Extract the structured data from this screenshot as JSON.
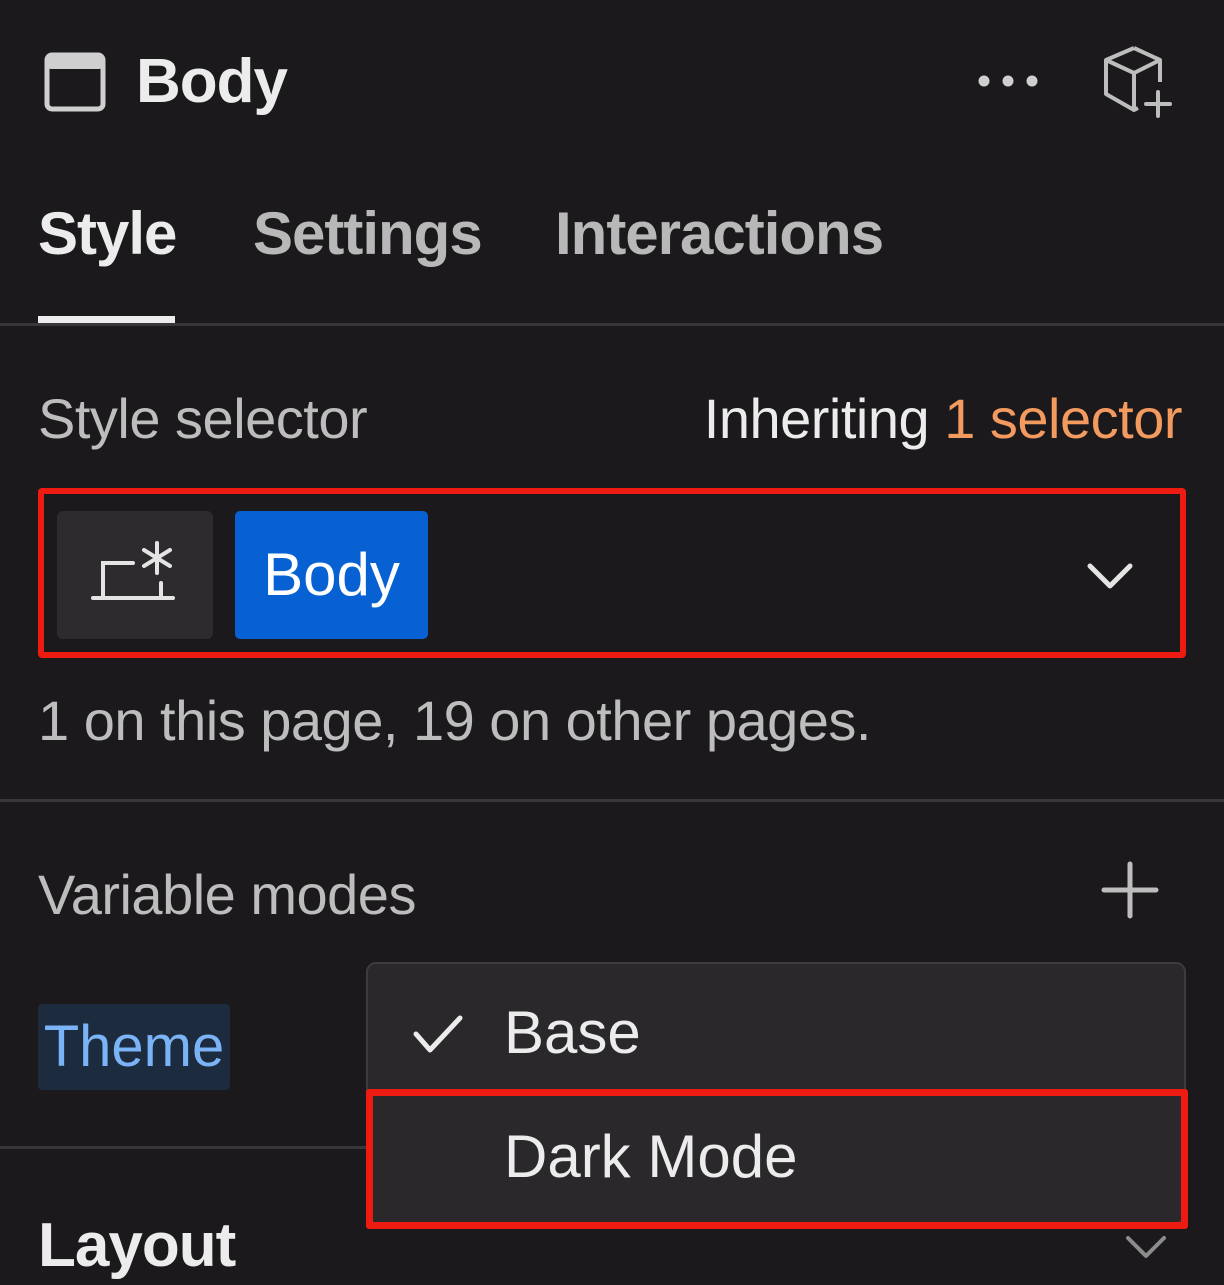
{
  "header": {
    "title": "Body",
    "element_icon": "window-icon",
    "more_icon": "more-horizontal-icon",
    "component_icon": "cube-plus-icon"
  },
  "tabs": [
    {
      "label": "Style",
      "active": true
    },
    {
      "label": "Settings",
      "active": false
    },
    {
      "label": "Interactions",
      "active": false
    }
  ],
  "style_selector": {
    "label": "Style selector",
    "inheriting_prefix": "Inheriting",
    "inheriting_link": "1 selector",
    "state_icon": "state-selector-icon",
    "chip_label": "Body",
    "usage_text": "1 on this page, 19 on other pages."
  },
  "variable_modes": {
    "label": "Variable modes",
    "theme_label": "Theme",
    "menu": [
      {
        "label": "Base",
        "checked": true
      },
      {
        "label": "Dark Mode",
        "checked": false
      }
    ]
  },
  "layout": {
    "title": "Layout"
  },
  "colors": {
    "background": "#1b191c",
    "accent_blue": "#0861d2",
    "link_orange": "#f39a5e",
    "highlight_red": "#ee1b12",
    "theme_blue": "#7ab3f6"
  }
}
